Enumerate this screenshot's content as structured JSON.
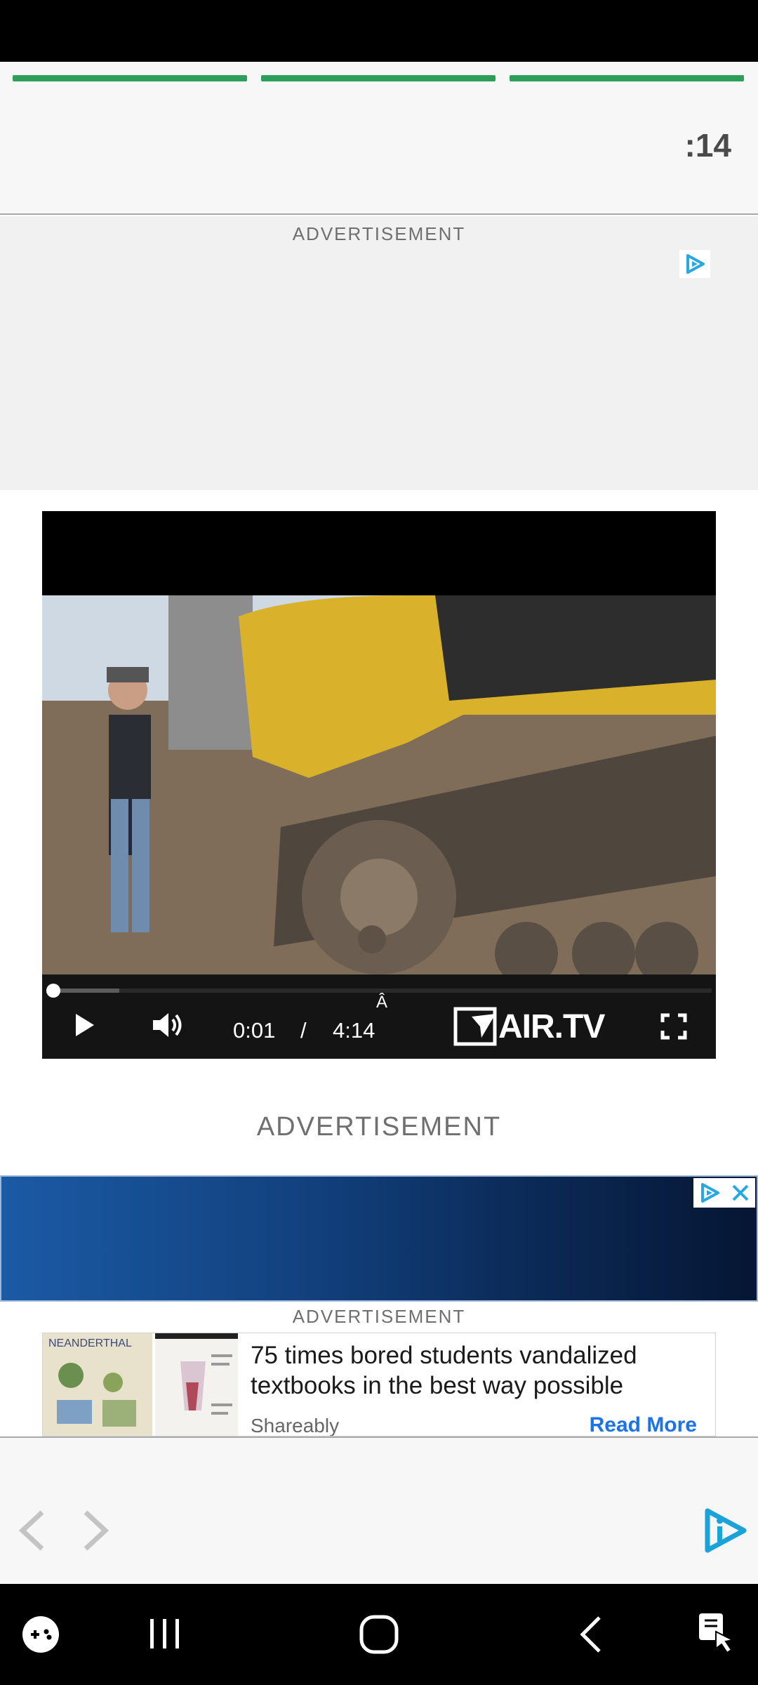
{
  "story": {
    "timer": ":14",
    "progress_count": 3
  },
  "ads": {
    "top_label": "ADVERTISEMENT",
    "mid_label": "ADVERTISEMENT",
    "native_label": "ADVERTISEMENT"
  },
  "video": {
    "current_time": "0:01",
    "separator": "/",
    "duration": "4:14",
    "stray_glyph": "Â",
    "brand": "AIR.TV",
    "played_fraction": 0.11
  },
  "native_ad": {
    "headline": "75 times bored students vandalized textbooks in the best way possible",
    "source": "Shareably",
    "cta": "Read More",
    "thumb_text": "NEANDERTHAL"
  },
  "colors": {
    "progress": "#2e9e5b",
    "adchoices": "#29a8e0",
    "cta": "#1a73e8"
  },
  "icons": {
    "prev": "chevron-left-icon",
    "next": "chevron-right-icon",
    "play": "play-icon",
    "volume": "volume-icon",
    "fullscreen": "fullscreen-icon",
    "brand": "arrow-i-logo-icon"
  }
}
